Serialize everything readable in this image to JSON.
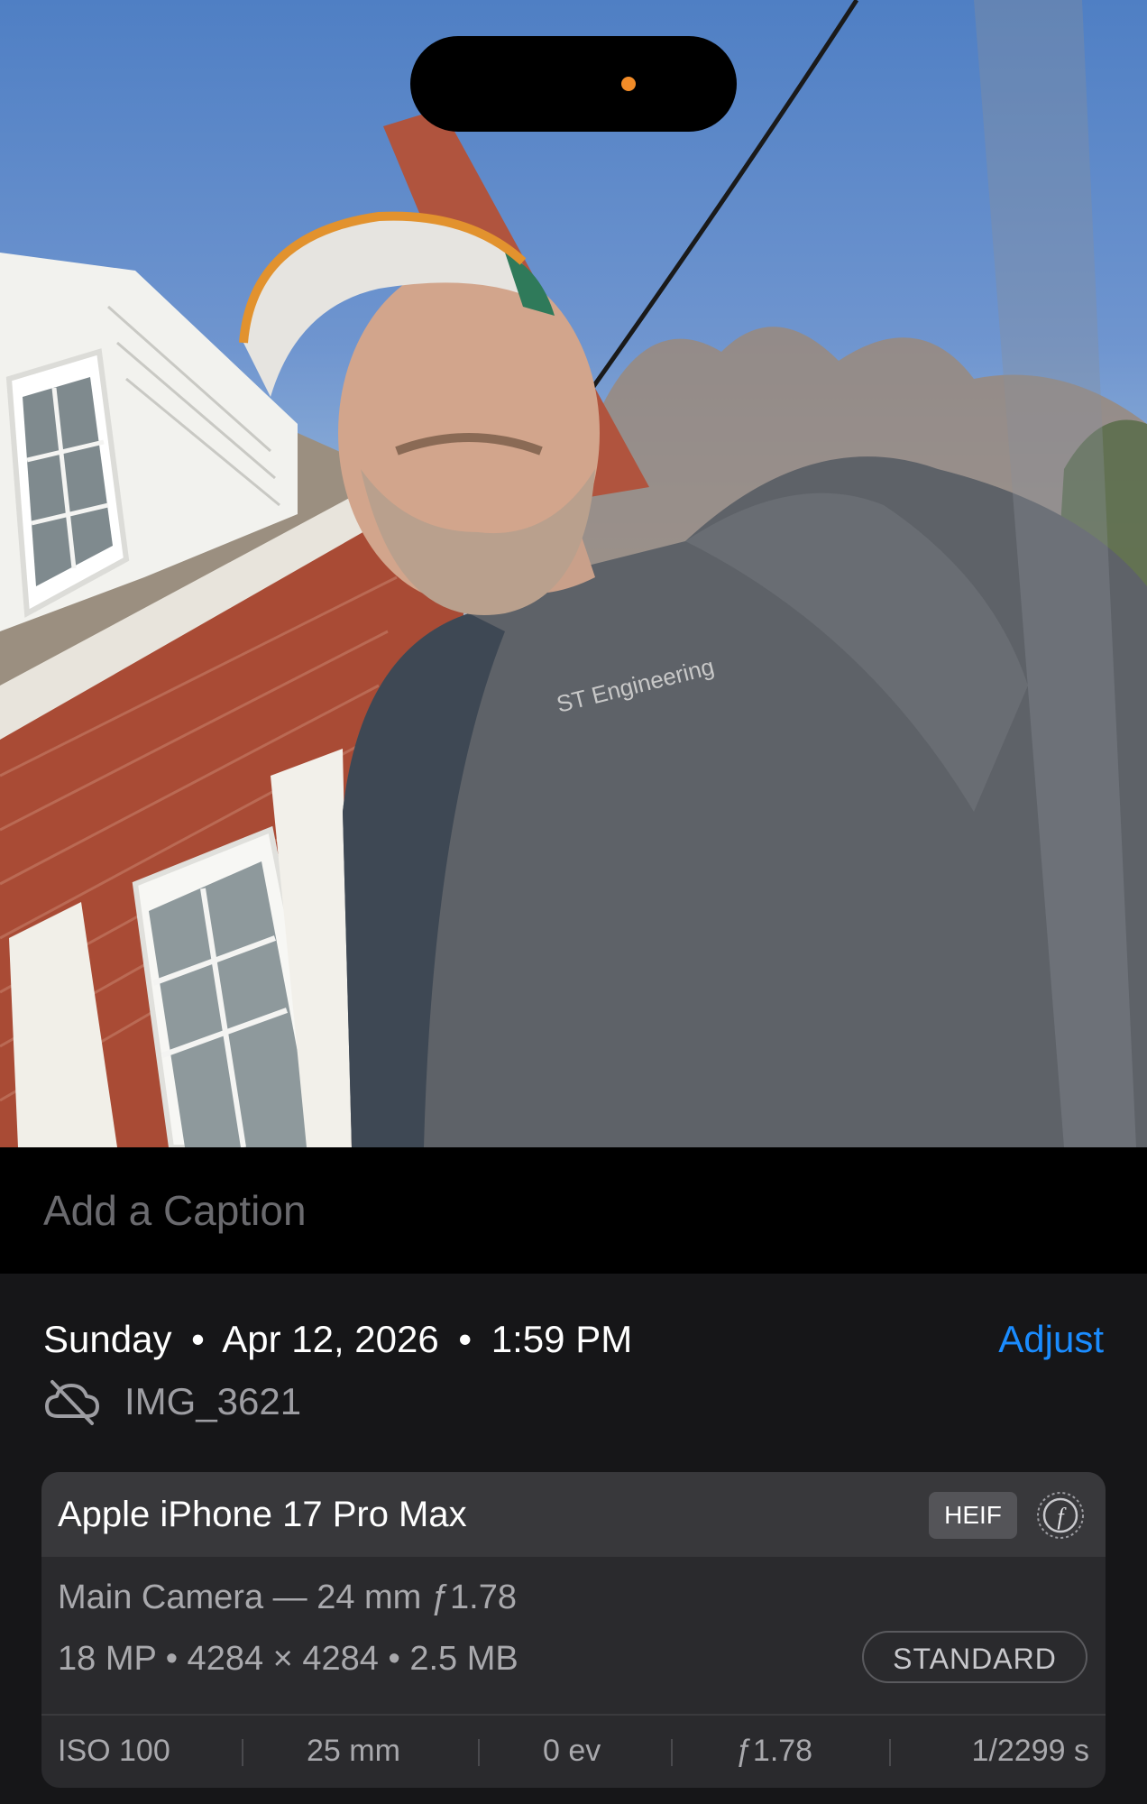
{
  "caption": {
    "placeholder": "Add a Caption"
  },
  "info": {
    "day": "Sunday",
    "date": "Apr 12, 2026",
    "time": "1:59 PM",
    "separator": "•",
    "adjust_label": "Adjust",
    "cloud_icon": "cloud-slash-icon",
    "filename": "IMG_3621"
  },
  "camera": {
    "device": "Apple iPhone 17 Pro Max",
    "format_badge": "HEIF",
    "badge_icon": "f-aperture-icon",
    "lens": "Main Camera — 24 mm ƒ1.78",
    "specs": "18 MP • 4284 × 4284 • 2.5 MB",
    "profile_badge": "STANDARD",
    "exif": {
      "iso": "ISO 100",
      "focal": "25 mm",
      "ev": "0 ev",
      "aperture": "ƒ1.78",
      "shutter": "1/2299 s"
    }
  },
  "colors": {
    "accent": "#1a8cff",
    "panel": "#161618",
    "card": "#2a2a2d",
    "recording_dot": "#f28c28"
  }
}
